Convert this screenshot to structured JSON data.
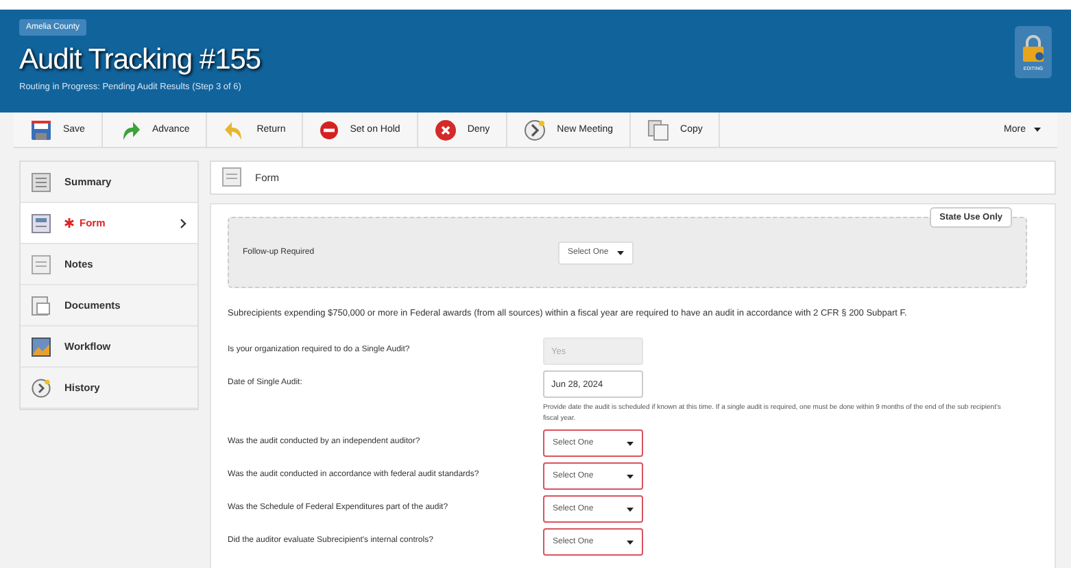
{
  "header": {
    "org": "Amelia County",
    "title": "Audit Tracking #155",
    "subtitle": "Routing in Progress: Pending Audit Results (Step 3 of 6)",
    "badge": "EDITING"
  },
  "toolbar": [
    {
      "kind": "save",
      "label": "Save"
    },
    {
      "kind": "advance",
      "label": "Advance"
    },
    {
      "kind": "return",
      "label": "Return"
    },
    {
      "kind": "hold",
      "label": "Set on Hold"
    },
    {
      "kind": "deny",
      "label": "Deny"
    },
    {
      "kind": "meeting",
      "label": "New Meeting"
    },
    {
      "kind": "copy",
      "label": "Copy"
    }
  ],
  "more": "More",
  "sidebar": {
    "items": [
      {
        "kind": "summary",
        "label": "Summary",
        "selected": false,
        "required": false
      },
      {
        "kind": "form",
        "label": "Form",
        "selected": true,
        "required": true
      },
      {
        "kind": "notes",
        "label": "Notes",
        "selected": false,
        "required": false
      },
      {
        "kind": "documents",
        "label": "Documents",
        "selected": false,
        "required": false
      },
      {
        "kind": "workflow",
        "label": "Workflow",
        "selected": false,
        "required": false
      },
      {
        "kind": "history",
        "label": "History",
        "selected": false,
        "required": false
      }
    ]
  },
  "form": {
    "title": "Form",
    "state_section": {
      "legend": "State Use Only",
      "label": "Follow-up Required",
      "placeholder": "Select One"
    },
    "intro": "Subrecipients expending $750,000 or more in Federal awards (from all sources) within a fiscal year are required to have an audit in accordance with 2 CFR § 200 Subpart F.",
    "fields": [
      {
        "kind": "text",
        "label": "Is your organization required to do a Single Audit?",
        "value": "Yes",
        "disabled": true
      },
      {
        "kind": "date",
        "label": "Date of Single Audit:",
        "value": "Jun 28, 2024",
        "disabled": false,
        "help": "Provide date the audit is scheduled if known at this time. If a single audit is required, one must be done within 9 months of the end of the sub recipient's fiscal year."
      },
      {
        "kind": "select",
        "label": "Was the audit conducted by an independent auditor?",
        "placeholder": "Select One",
        "invalid": true
      },
      {
        "kind": "select",
        "label": "Was the audit conducted in accordance with federal audit standards?",
        "placeholder": "Select One",
        "invalid": true
      },
      {
        "kind": "select",
        "label": "Was the Schedule of Federal Expenditures part of the audit?",
        "placeholder": "Select One",
        "invalid": true
      },
      {
        "kind": "select",
        "label": "Did the auditor evaluate Subrecipient's internal controls?",
        "placeholder": "Select One",
        "invalid": true
      }
    ]
  }
}
